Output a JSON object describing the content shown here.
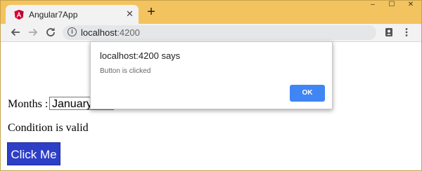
{
  "browser": {
    "tab_title": "Angular7App",
    "tab_close": "✕",
    "new_tab": "+",
    "url_host": "localhost",
    "url_port": ":4200",
    "window_controls": [
      "–",
      "☐",
      "✕"
    ]
  },
  "page": {
    "months_label": "Months :",
    "months_selected": "January",
    "condition_text": "Condition is valid",
    "button_label": "Click Me"
  },
  "dialog": {
    "title": "localhost:4200 says",
    "message": "Button is clicked",
    "ok_label": "OK"
  },
  "colors": {
    "titlebar": "#f3c35f",
    "button_bg": "#2d3ec7",
    "dialog_ok": "#3f85f4",
    "angular_red": "#dd0031"
  },
  "icons": [
    "angular-icon",
    "back-arrow-icon",
    "forward-arrow-icon",
    "reload-icon",
    "info-icon",
    "profile-icon",
    "menu-kebab-icon"
  ]
}
